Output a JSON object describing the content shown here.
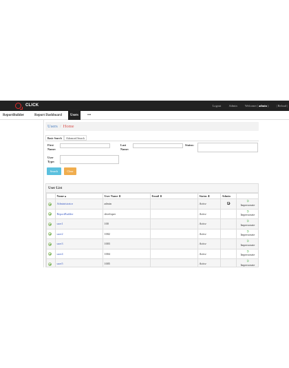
{
  "app": {
    "brand": "CLICK"
  },
  "topbar": {
    "logout": "Logout",
    "admin": "Admin",
    "welcome": "Welcome",
    "user": "admin",
    "reload": "Reload"
  },
  "menu": {
    "items": [
      "ReportBuilder",
      "Report Dashboard",
      "Users",
      "•••"
    ]
  },
  "breadcrumb": {
    "section": "Users",
    "separator": "/",
    "current": "Home"
  },
  "search": {
    "tabs": [
      "Basic Search",
      "Advanced Search"
    ],
    "first_name": "First Name:",
    "last_name": "Last Name:",
    "status": "Status:",
    "user_type": "User Type:",
    "search_button": "Search",
    "clear_button": "Clear"
  },
  "user_list": {
    "title": "User List",
    "columns": [
      "",
      "Name ▴",
      "User Name ⬍",
      "Email ⬍",
      "Status ⬍",
      "Admin",
      ""
    ],
    "impersonate_label": "Impersonate",
    "rows": [
      {
        "name": "Administrator",
        "username": "admin",
        "email": "",
        "status": "Active",
        "admin": true
      },
      {
        "name": "ReportBuilder",
        "username": "developer",
        "email": "",
        "status": "Active",
        "admin": false
      },
      {
        "name": "user1",
        "username": "100",
        "email": "",
        "status": "Active",
        "admin": false
      },
      {
        "name": "user2",
        "username": "1002",
        "email": "",
        "status": "Active",
        "admin": false
      },
      {
        "name": "user3",
        "username": "1003",
        "email": "",
        "status": "Active",
        "admin": false
      },
      {
        "name": "user4",
        "username": "1004",
        "email": "",
        "status": "Active",
        "admin": false
      },
      {
        "name": "user5",
        "username": "1005",
        "email": "",
        "status": "Active",
        "admin": false
      }
    ]
  },
  "colors": {
    "topbar": "#222222",
    "accent": "#e02a2a",
    "search": "#5bc0de",
    "clear": "#f0ad4e",
    "link": "#3b5bc4"
  }
}
